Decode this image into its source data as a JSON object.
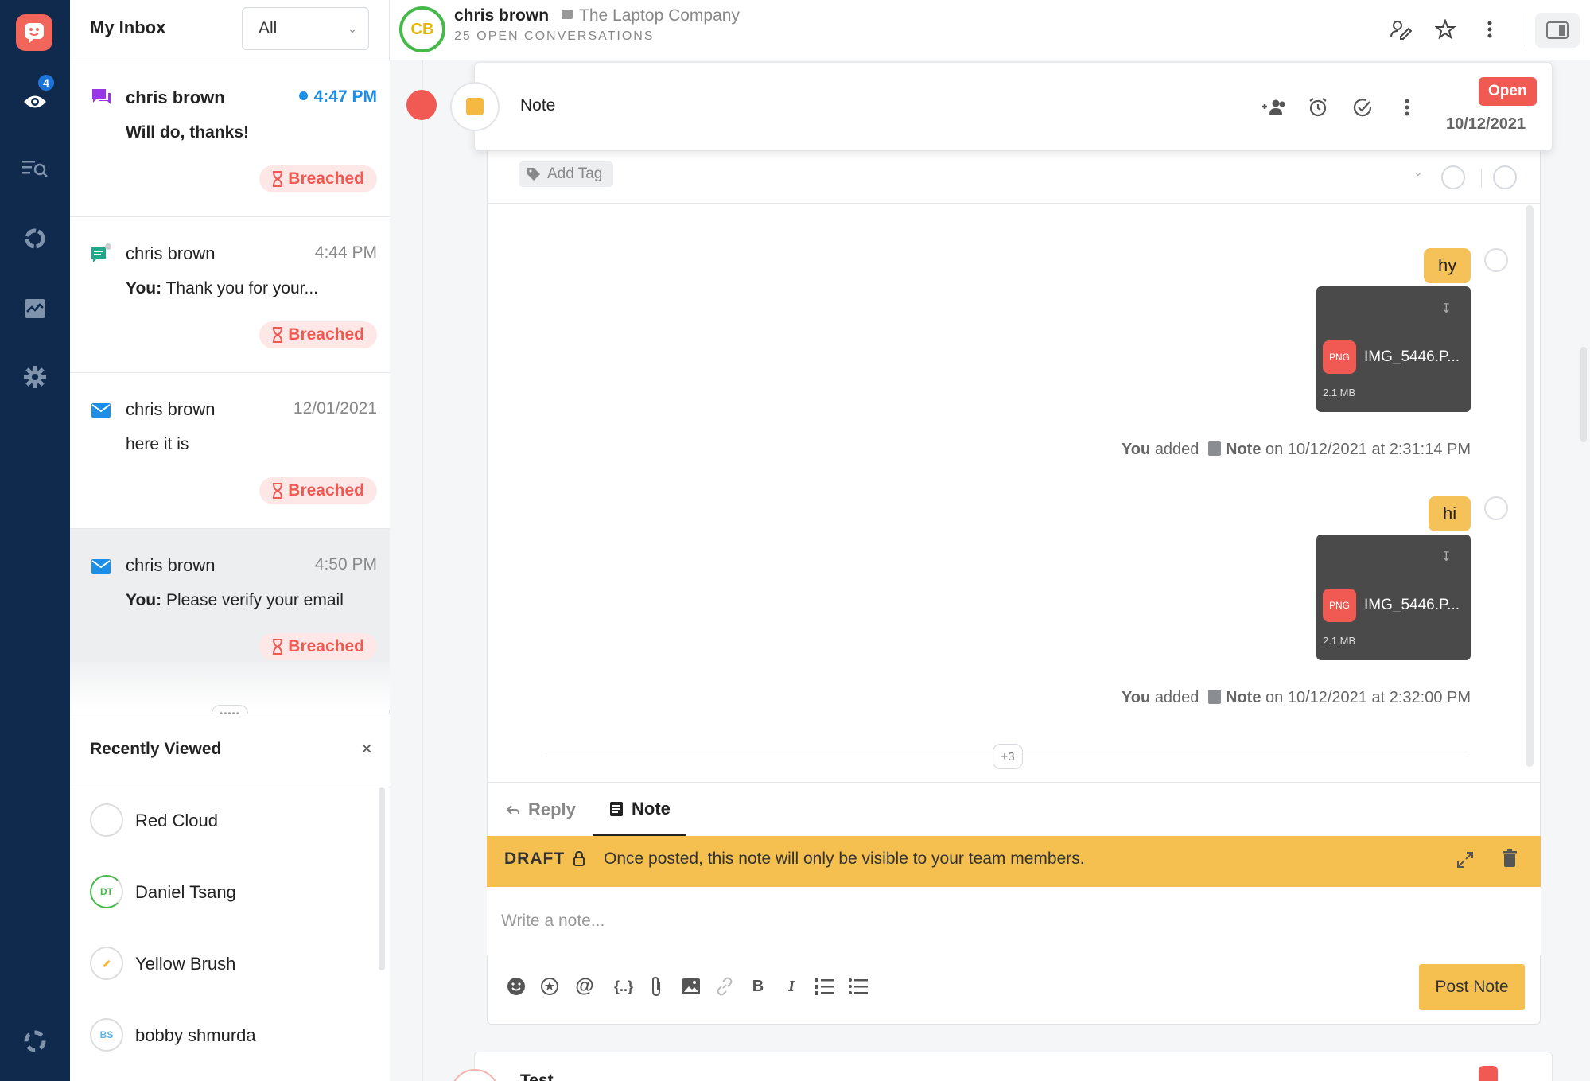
{
  "nav": {
    "badge_count": "4"
  },
  "inbox": {
    "title": "My Inbox",
    "filter": "All",
    "conversations": [
      {
        "name": "chris brown",
        "time": "4:47 PM",
        "preview_label": "",
        "preview": "Will do, thanks!",
        "sla": "Breached"
      },
      {
        "name": "chris brown",
        "time": "4:44 PM",
        "preview_label": "You:",
        "preview": " Thank you for your...",
        "sla": "Breached"
      },
      {
        "name": "chris brown",
        "time": "12/01/2021",
        "preview_label": "",
        "preview": "here it is",
        "sla": "Breached"
      },
      {
        "name": "chris brown",
        "time": "4:50 PM",
        "preview_label": "You:",
        "preview": " Please verify your email",
        "sla": "Breached"
      }
    ]
  },
  "recently_viewed": {
    "title": "Recently Viewed",
    "items": [
      {
        "name": "Red Cloud",
        "initials": ""
      },
      {
        "name": "Daniel Tsang",
        "initials": "DT"
      },
      {
        "name": "Yellow Brush",
        "initials": ""
      },
      {
        "name": "bobby shmurda",
        "initials": "BS"
      }
    ]
  },
  "header": {
    "avatar_initials": "CB",
    "customer_name": "chris brown",
    "company": "The Laptop Company",
    "open_conversations": "25 OPEN CONVERSATIONS"
  },
  "note_card": {
    "title": "Note",
    "status": "Open",
    "date": "10/12/2021",
    "add_tag": "Add Tag"
  },
  "messages": [
    {
      "text": "hy",
      "file_type": "PNG",
      "file_name": "IMG_5446.P...",
      "file_size": "2.1 MB",
      "added_by": "You",
      "added_verb": "added",
      "added_item": "Note",
      "added_on": "on 10/12/2021 at 2:31:14 PM"
    },
    {
      "text": "hi",
      "file_type": "PNG",
      "file_name": "IMG_5446.P...",
      "file_size": "2.1 MB",
      "added_by": "You",
      "added_verb": "added",
      "added_item": "Note",
      "added_on": "on 10/12/2021 at 2:32:00 PM"
    }
  ],
  "more_count": "+3",
  "composer": {
    "tab_reply": "Reply",
    "tab_note": "Note",
    "draft_label": "DRAFT",
    "draft_message": "Once posted, this note will only be visible to your team members.",
    "placeholder": "Write a note...",
    "post_button": "Post Note"
  },
  "next_card": {
    "title": "Test"
  },
  "colors": {
    "rail": "#0f2a4d",
    "brand": "#f2655b",
    "breached": "#ee5a52",
    "unread": "#1d8ee6",
    "draft_bar": "#f5c04f",
    "status_open": "#f05a52"
  },
  "icons": [
    "logo-icon",
    "eye-icon",
    "search-list-icon",
    "reports-icon",
    "activity-icon",
    "gear-icon",
    "help-icon",
    "chat-icon",
    "email-icon",
    "hourglass-icon",
    "edit-icon",
    "star-icon",
    "more-icon",
    "panel-icon",
    "note-icon",
    "assign-icon",
    "snooze-icon",
    "resolve-icon",
    "tag-icon",
    "download-icon",
    "lock-icon",
    "expand-icon",
    "trash-icon",
    "emoji-icon",
    "canned-icon",
    "mention-icon",
    "variable-icon",
    "attach-icon",
    "image-icon",
    "link-icon",
    "bold-icon",
    "italic-icon",
    "ordered-list-icon",
    "bullet-list-icon"
  ]
}
